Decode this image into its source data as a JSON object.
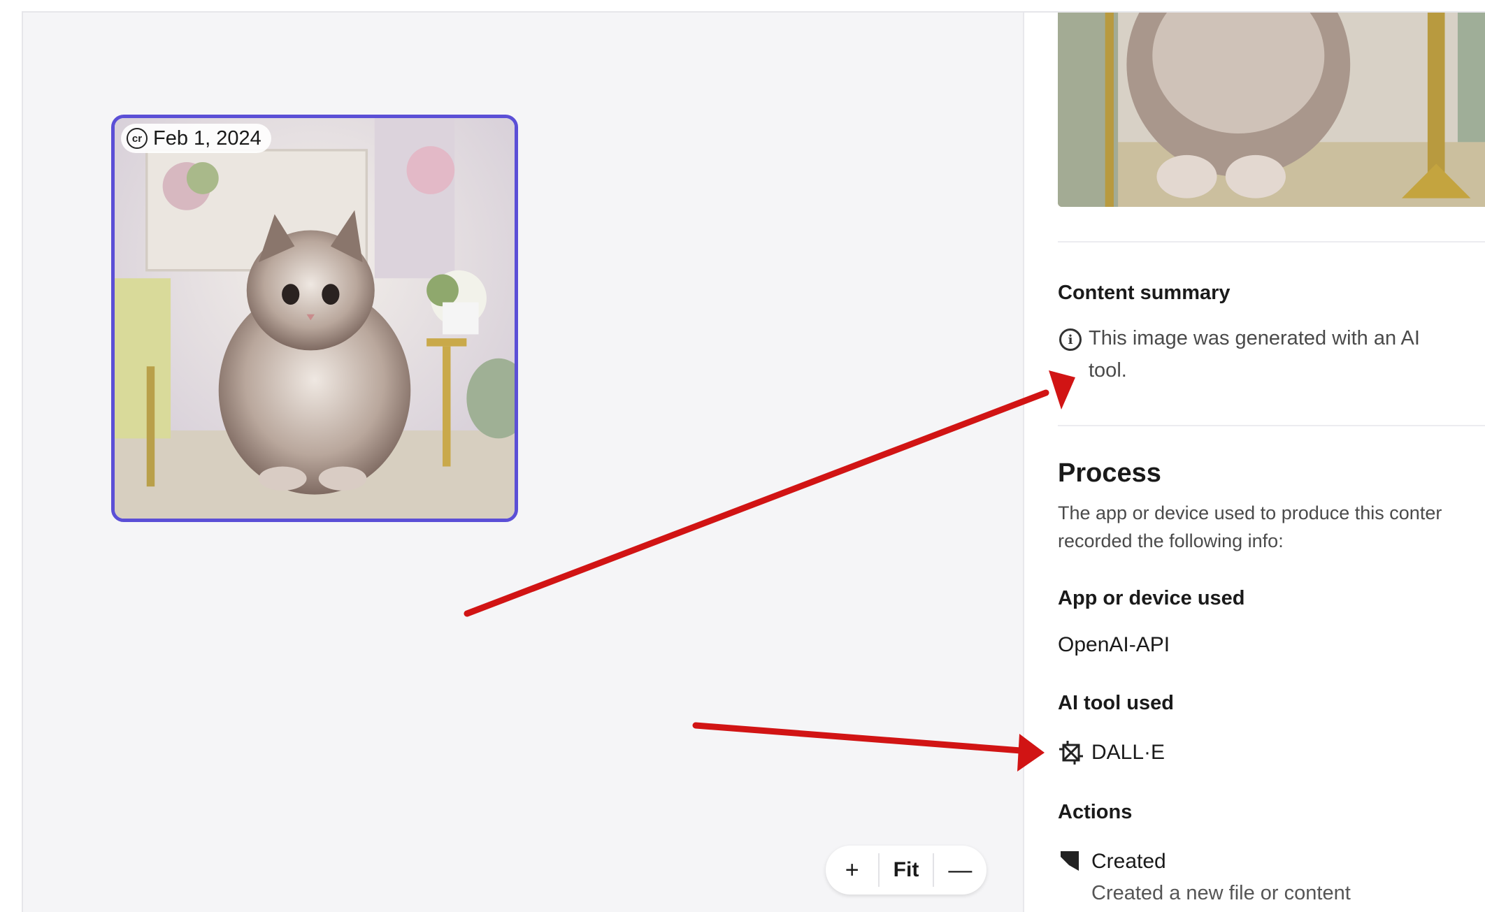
{
  "thumbnail": {
    "date_label": "Feb 1, 2024",
    "badge_icon": "cr"
  },
  "zoom_controls": {
    "zoom_in": "+",
    "fit": "Fit",
    "zoom_out": "—"
  },
  "panel": {
    "content_summary": {
      "heading": "Content summary",
      "line1": "This image was generated with an AI",
      "line2": "tool."
    },
    "process": {
      "heading": "Process",
      "line1": "The app or device used to produce this conter",
      "line2": "recorded the following info:"
    },
    "app_used": {
      "heading": "App or device used",
      "value": "OpenAI-API"
    },
    "ai_tool": {
      "heading": "AI tool used",
      "value": "DALL·E"
    },
    "actions": {
      "heading": "Actions",
      "item_title": "Created",
      "item_desc": "Created a new file or content"
    }
  },
  "colors": {
    "selection_border": "#5b4fd6",
    "annotation_arrow": "#d11414"
  }
}
